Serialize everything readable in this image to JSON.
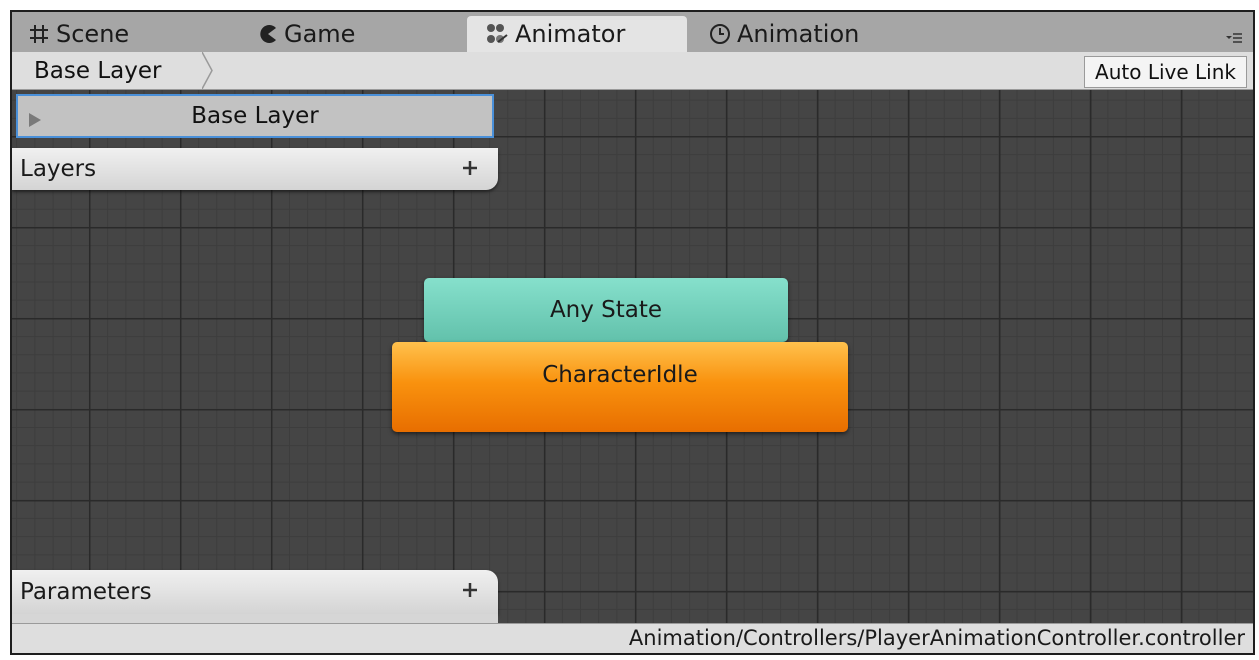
{
  "tabs": [
    {
      "label": "Scene",
      "icon": "grid-icon"
    },
    {
      "label": "Game",
      "icon": "pacman-icon"
    },
    {
      "label": "Animator",
      "icon": "animator-icon",
      "active": true
    },
    {
      "label": "Animation",
      "icon": "clock-icon"
    }
  ],
  "toolbar": {
    "breadcrumb": "Base Layer",
    "live_link_label": "Auto Live Link"
  },
  "layers_panel": {
    "selected_layer": "Base Layer",
    "header": "Layers"
  },
  "parameters_panel": {
    "header": "Parameters"
  },
  "states": {
    "any_state": "Any State",
    "default_state": "CharacterIdle"
  },
  "status": {
    "asset_path": "Animation/Controllers/PlayerAnimationController.controller"
  },
  "colors": {
    "any_state": "#6fcfb9",
    "default_state": "#f28a00",
    "canvas_bg": "#454545",
    "selection": "#4a90d9"
  }
}
